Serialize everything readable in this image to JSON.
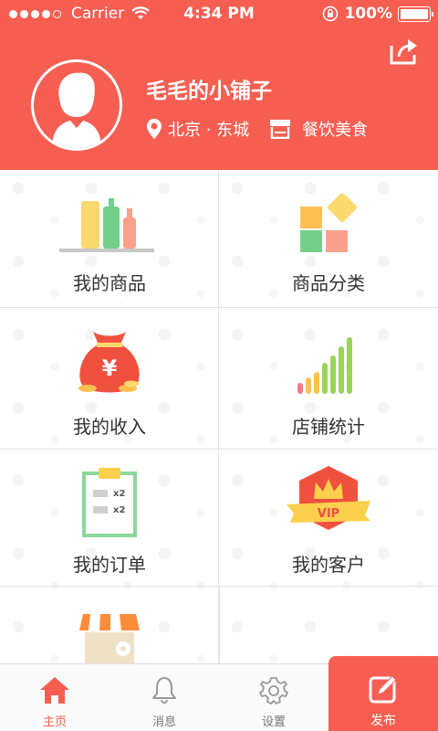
{
  "status_bar": {
    "carrier": "Carrier",
    "time": "4:34 PM",
    "battery": "100%",
    "battery_level": 1.0
  },
  "header": {
    "shop_name": "毛毛的小铺子",
    "location": "北京 · 东城",
    "category": "餐饮美食"
  },
  "grid": {
    "items": [
      {
        "label": "我的商品",
        "icon": "products-icon"
      },
      {
        "label": "商品分类",
        "icon": "category-icon"
      },
      {
        "label": "我的收入",
        "icon": "money-bag-icon"
      },
      {
        "label": "店铺统计",
        "icon": "bar-chart-icon"
      },
      {
        "label": "我的订单",
        "icon": "order-clipboard-icon"
      },
      {
        "label": "我的客户",
        "icon": "vip-crown-icon"
      },
      {
        "label": "",
        "icon": "storefront-icon"
      }
    ],
    "order_badges": [
      "x2",
      "x2"
    ],
    "vip_text": "VIP"
  },
  "tabbar": {
    "tabs": [
      {
        "label": "主页",
        "icon": "home-icon"
      },
      {
        "label": "消息",
        "icon": "bell-icon"
      },
      {
        "label": "设置",
        "icon": "gear-icon"
      },
      {
        "label": "发布",
        "icon": "edit-icon"
      }
    ]
  },
  "colors": {
    "accent": "#f65e52",
    "grid_border": "#e3e3e3",
    "text": "#333333"
  }
}
